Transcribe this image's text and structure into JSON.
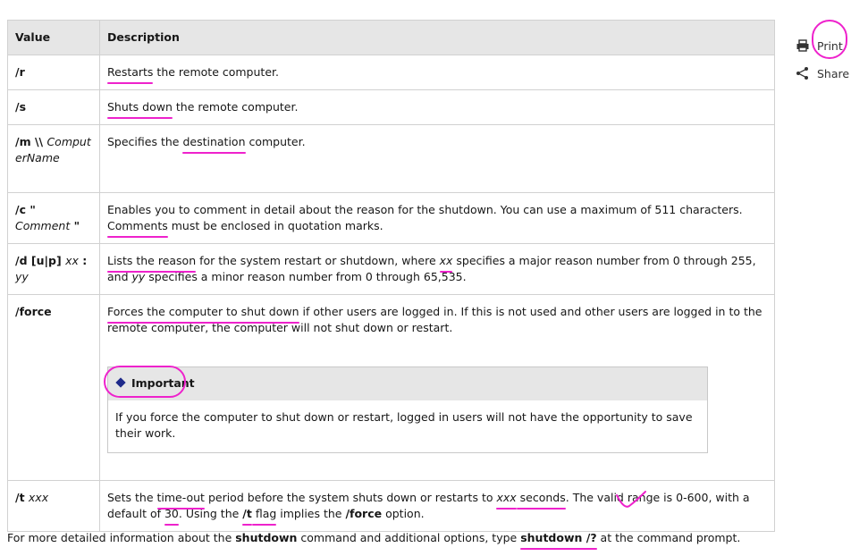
{
  "table": {
    "headers": [
      "Value",
      "Description"
    ],
    "rows": [
      {
        "value": "/r",
        "value_italic": "",
        "desc_parts": [
          "Restarts",
          " the remote computer."
        ]
      },
      {
        "value": "/s",
        "value_italic": "",
        "desc_parts": [
          "Shuts down",
          " the remote computer."
        ]
      },
      {
        "value": "/m \\\\",
        "value_italic": "ComputerName",
        "desc_parts": [
          "Specifies the ",
          "destination",
          " computer."
        ]
      },
      {
        "value": "/c \"",
        "value_italic": "Comment",
        "value_tail": "\"",
        "desc_parts": [
          "Enables you to comment in detail about the reason for the shutdown. You can use a maximum of 511 characters. ",
          "Comments",
          " must be enclosed in quotation marks."
        ]
      },
      {
        "value": "/d [u|p]",
        "value_italic": "xx",
        "value_mid": ":",
        "value_italic2": "yy",
        "desc_parts": [
          "Lists the reason",
          " for the system restart or shutdown, where ",
          "xx",
          " specifies a major reason number from 0 through 255, and ",
          "yy",
          " specifies a minor reason number from 0 through 65,535."
        ]
      },
      {
        "value": "/force",
        "desc_parts": [
          "Forces the computer to shut down",
          " if other users are logged in. If this is not used and other users are logged in to the remote computer, the computer will not shut down or restart."
        ]
      },
      {
        "value": "/t",
        "value_italic": "xxx",
        "desc_parts": [
          "Sets the ",
          "time-out",
          " period before the system shuts down or restarts to ",
          "xxx",
          " seconds",
          ". The valid range is 0-600, with a default of ",
          "30",
          ". Using the ",
          "/t",
          " flag",
          " implies the ",
          "/force",
          " option."
        ]
      }
    ]
  },
  "important": {
    "title": "Important",
    "body_parts": [
      "If you force the computer to shut down or restart, ",
      "logged in users will not have the opportunity to save their work."
    ]
  },
  "footer": {
    "parts": [
      "For more detailed information about the ",
      "shutdown",
      " command and additional options, type ",
      "shutdown /?",
      " at the command prompt."
    ]
  },
  "actions": {
    "print_label": "Print",
    "share_label": "Share"
  },
  "colors": {
    "annotation": "#ee22cc",
    "header_bg": "#e6e6e6",
    "diamond": "#1e2a8a"
  }
}
